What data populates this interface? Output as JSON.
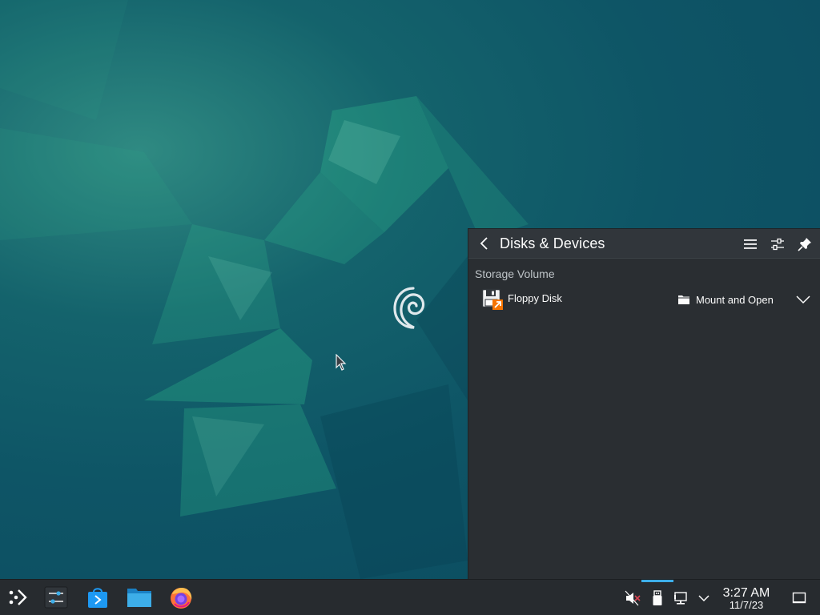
{
  "panel": {
    "title": "Disks & Devices",
    "section_label": "Storage Volume",
    "devices": [
      {
        "name": "Floppy Disk",
        "action_label": "Mount and Open",
        "icon": "floppy-disk-icon"
      }
    ],
    "header_icons": [
      "back-arrow-icon",
      "hamburger-menu-icon",
      "settings-sliders-icon",
      "pin-icon"
    ]
  },
  "taskbar": {
    "apps": [
      "application-launcher-icon",
      "system-settings-icon",
      "discover-store-icon",
      "file-manager-icon",
      "firefox-icon"
    ],
    "tray": [
      "muted-speaker-icon",
      "usb-removable-icon",
      "network-wired-icon",
      "tray-expand-chevron-icon"
    ],
    "clock": {
      "time": "3:27 AM",
      "date": "11/7/23"
    },
    "show_desktop_icon": "show-desktop-icon"
  },
  "colors": {
    "accent": "#3daee9",
    "panel_bg": "#2a2e32",
    "taskbar_bg": "#272b2f",
    "floppy_badge": "#f67400"
  }
}
